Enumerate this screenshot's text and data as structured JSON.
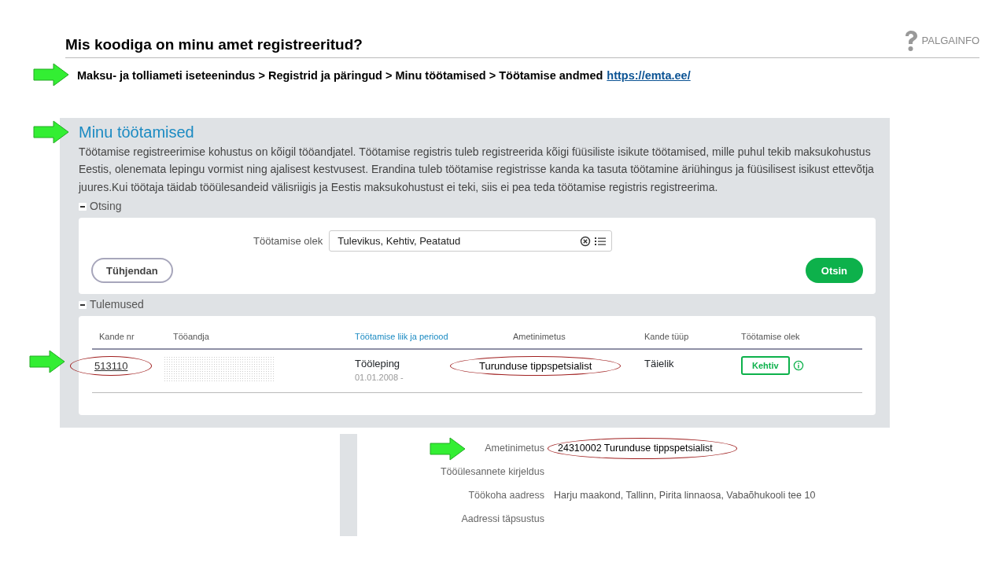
{
  "slide": {
    "title": "Mis koodiga on minu amet registreeritud?",
    "logo": "PALGAINFO",
    "path": "Maksu- ja tolliameti iseteenindus > Registrid ja päringud > Minu töötamised > Töötamise andmed",
    "link": "https://emta.ee/"
  },
  "page": {
    "title": "Minu töötamised",
    "intro": "Töötamise registreerimise kohustus on kõigil tööandjatel. Töötamise registris tuleb registreerida kõigi füüsiliste isikute töötamised, mille puhul tekib maksukohustus Eestis, olenemata lepingu vormist ning ajalisest kestvusest. Erandina tuleb töötamise registrisse kanda ka tasuta töötamine äriühingus ja füüsilisest isikust ettevõtja juures.Kui töötaja täidab tööülesandeid välisriigis ja Eestis maksukohustust ei teki, siis ei pea teda töötamise registris registreerima.",
    "search_section": {
      "label": "Otsing",
      "expanded": true
    },
    "filter": {
      "label": "Töötamise olek",
      "value": "Tulevikus, Kehtiv, Peatatud"
    },
    "buttons": [
      {
        "label": "Tühjendan",
        "kind": "secondary"
      },
      {
        "label": "Otsin",
        "kind": "primary"
      }
    ],
    "results_section": {
      "label": "Tulemused",
      "expanded": true
    },
    "table": {
      "columns": [
        {
          "label": "Kande nr",
          "sorted": false
        },
        {
          "label": "Tööandja",
          "sorted": false
        },
        {
          "label": "Töötamise liik ja periood",
          "sorted": true
        },
        {
          "label": "Ametinimetus",
          "sorted": false
        },
        {
          "label": "Kande tüüp",
          "sorted": false
        },
        {
          "label": "Töötamise olek",
          "sorted": false
        }
      ],
      "rows": [
        {
          "entry_no": "513110",
          "entry_no_circled": true,
          "employer_redacted": true,
          "type": "Tööleping",
          "period": "01.01.2008 -",
          "job_title": "Turunduse tippspetsialist",
          "job_title_circled": true,
          "entry_type": "Täielik",
          "status": "Kehtiv"
        }
      ]
    }
  },
  "details": [
    {
      "label": "Ametinimetus",
      "value": "24310002 Turunduse tippspetsialist",
      "circled": true
    },
    {
      "label": "Tööülesannete kirjeldus"
    },
    {
      "label": "Töökoha aadress",
      "value": "Harju maakond, Tallinn, Pirita linnaosa, Vabaõhukooli tee 10",
      "circled": false
    },
    {
      "label": "Aadressi täpsustus"
    }
  ]
}
